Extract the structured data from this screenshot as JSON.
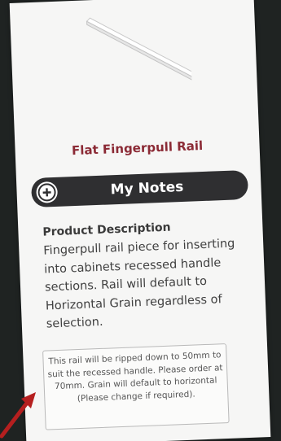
{
  "product": {
    "title": "Flat Fingerpull Rail",
    "image_icon": "rail-piece-image"
  },
  "notes": {
    "label": "My Notes",
    "icon": "plus-circle-icon"
  },
  "description": {
    "heading": "Product Description",
    "body": "Fingerpull rail piece for inserting into cabinets recessed handle sections. Rail will default to Horizontal Grain regardless of selection."
  },
  "note_box": {
    "text": "This rail will be ripped down to 50mm to suit the recessed handle. Please order at 70mm. Grain will default to horizontal (Please change if required)."
  },
  "colors": {
    "title": "#8b2a35",
    "notes_bar": "#2f2f31",
    "arrow": "#b51f1f",
    "background": "#1f2322"
  }
}
